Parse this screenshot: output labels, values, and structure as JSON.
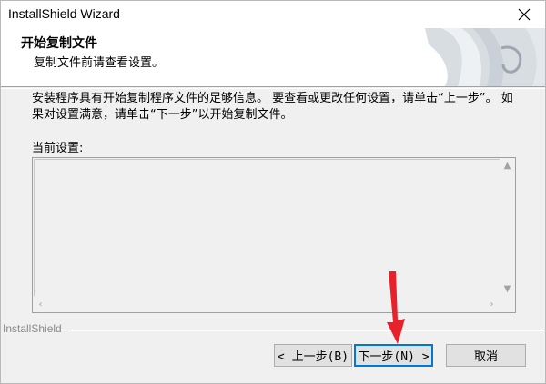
{
  "window": {
    "title": "InstallShield Wizard"
  },
  "header": {
    "title": "开始复制文件",
    "subtitle": "复制文件前请查看设置。"
  },
  "body": {
    "description": "安装程序具有开始复制程序文件的足够信息。 要查看或更改任何设置，请单击“上一步”。 如果对设置满意，请单击“下一步”以开始复制文件。",
    "settings_label": "当前设置:",
    "settings_value": ""
  },
  "footer": {
    "brand": "InstallShield"
  },
  "buttons": {
    "back": "< 上一步(B)",
    "next": "下一步(N) >",
    "cancel": "取消"
  },
  "annotation": {
    "arrow_color": "#e8222a"
  }
}
